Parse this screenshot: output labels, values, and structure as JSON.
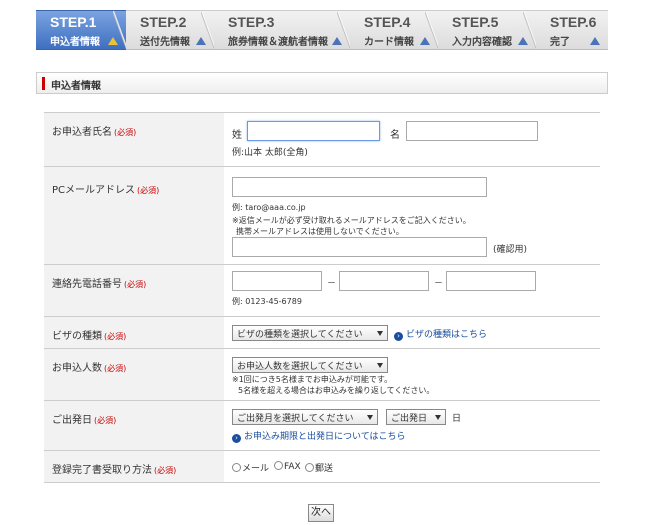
{
  "steps": [
    {
      "num": "STEP.1",
      "label": "申込者情報",
      "active": true
    },
    {
      "num": "STEP.2",
      "label": "送付先情報",
      "active": false
    },
    {
      "num": "STEP.3",
      "label": "旅券情報＆渡航者情報",
      "active": false
    },
    {
      "num": "STEP.4",
      "label": "カード情報",
      "active": false
    },
    {
      "num": "STEP.5",
      "label": "入力内容確認",
      "active": false
    },
    {
      "num": "STEP.6",
      "label": "完了",
      "active": false
    }
  ],
  "section_title": "申込者情報",
  "required_mark": "(必須)",
  "name_row": {
    "label": "お申込者氏名",
    "sei": "姓",
    "mei": "名",
    "example": "例:山本 太郎(全角)"
  },
  "email_row": {
    "label": "PCメールアドレス",
    "example": "例: taro@aaa.co.jp",
    "note1": "※返信メールが必ず受け取れるメールアドレスをご記入ください。",
    "note2": "携帯メールアドレスは使用しないでください。",
    "confirm": "(確認用)"
  },
  "phone_row": {
    "label": "連絡先電話番号",
    "dash": "－",
    "example": "例: 0123-45-6789"
  },
  "visa_row": {
    "label": "ビザの種類",
    "select": "ビザの種類を選択してください",
    "link": "ビザの種類はこちら"
  },
  "people_row": {
    "label": "お申込人数",
    "select": "お申込人数を選択してください",
    "note1": "※1回につき5名様までお申込みが可能です。",
    "note2": "5名様を超える場合はお申込みを繰り返してください。"
  },
  "depart_row": {
    "label": "ご出発日",
    "select_month": "ご出発月を選択してください",
    "select_day": "ご出発日",
    "day_unit": "日",
    "link": "お申込み期限と出発日についてはこちら"
  },
  "delivery_row": {
    "label": "登録完了書受取り方法",
    "options": [
      "メール",
      "FAX",
      "郵送"
    ]
  },
  "next_button": "次へ",
  "colors": {
    "accent": "#3f6fc0",
    "required": "#cc0000",
    "link": "#1a4ea0"
  }
}
